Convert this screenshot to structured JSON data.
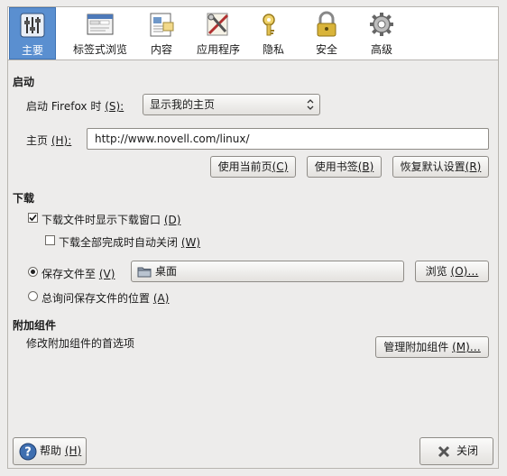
{
  "tabs": [
    {
      "label": "主要",
      "icon": "sliders-icon",
      "active": true
    },
    {
      "label": "标签式浏览",
      "icon": "tabs-window-icon",
      "active": false
    },
    {
      "label": "内容",
      "icon": "content-document-icon",
      "active": false
    },
    {
      "label": "应用程序",
      "icon": "applications-tools-icon",
      "active": false
    },
    {
      "label": "隐私",
      "icon": "privacy-key-icon",
      "active": false
    },
    {
      "label": "安全",
      "icon": "padlock-icon",
      "active": false
    },
    {
      "label": "高级",
      "icon": "gear-icon",
      "active": false
    }
  ],
  "startup": {
    "heading": "启动",
    "when_label": "启动 Firefox 时",
    "when_key": "(S):",
    "when_value": "显示我的主页",
    "home_label": "主页",
    "home_key": "(H):",
    "home_value": "http://www.novell.com/linux/",
    "use_current_label": "使用当前页",
    "use_current_key": "(C)",
    "use_bookmark_label": "使用书签",
    "use_bookmark_key": "(B)",
    "restore_default_label": "恢复默认设置",
    "restore_default_key": "(R)"
  },
  "downloads": {
    "heading": "下载",
    "show_window_label": "下载文件时显示下载窗口",
    "show_window_key": "(D)",
    "show_window_checked": true,
    "auto_close_label": "下载全部完成时自动关闭",
    "auto_close_key": "(W)",
    "auto_close_checked": false,
    "save_to_label": "保存文件至",
    "save_to_key": "(V)",
    "save_to_selected": true,
    "folder_value": "桌面",
    "browse_label": "浏览",
    "browse_key": "(O)…",
    "always_ask_label": "总询问保存文件的位置",
    "always_ask_key": "(A)",
    "always_ask_selected": false
  },
  "addons": {
    "heading": "附加组件",
    "description": "修改附加组件的首选项",
    "manage_label": "管理附加组件",
    "manage_key": "(M)…"
  },
  "footer": {
    "help_label": "帮助",
    "help_key": "(H)",
    "close_label": "关闭"
  }
}
